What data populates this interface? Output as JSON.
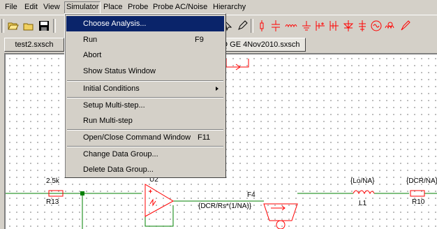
{
  "menubar": [
    "File",
    "Edit",
    "View",
    "Simulator",
    "Place",
    "Probe",
    "Probe AC/Noise",
    "Hierarchy"
  ],
  "tabs": [
    "test2.sxsch",
    "OQ GE 4Nov2010.sxsch"
  ],
  "menu": {
    "items": [
      {
        "label": "Choose Analysis...",
        "shortcut": ""
      },
      {
        "label": "Run",
        "shortcut": "F9"
      },
      {
        "label": "Abort",
        "shortcut": ""
      },
      {
        "label": "Show Status Window",
        "shortcut": ""
      },
      {
        "label": "Initial Conditions",
        "shortcut": ""
      },
      {
        "label": "Setup Multi-step...",
        "shortcut": ""
      },
      {
        "label": "Run Multi-step",
        "shortcut": ""
      },
      {
        "label": "Open/Close Command Window",
        "shortcut": "F11"
      },
      {
        "label": "Change Data Group...",
        "shortcut": ""
      },
      {
        "label": "Delete Data Group...",
        "shortcut": ""
      }
    ]
  },
  "schematic": {
    "r13_value": "2.5k",
    "r13_name": "R13",
    "u2_name": "U2",
    "f4_name": "F4",
    "f4_value": "{DCR/Rs*(1/NA)}",
    "l1_value": "{Lo/NA}",
    "l1_name": "L1",
    "r10_value": "{DCR/NA}",
    "r10_name": "R10"
  },
  "colors": {
    "menu_highlight": "#0a246a",
    "wire": "#008000",
    "component": "#ff0000",
    "grid_dot": "#808080"
  }
}
